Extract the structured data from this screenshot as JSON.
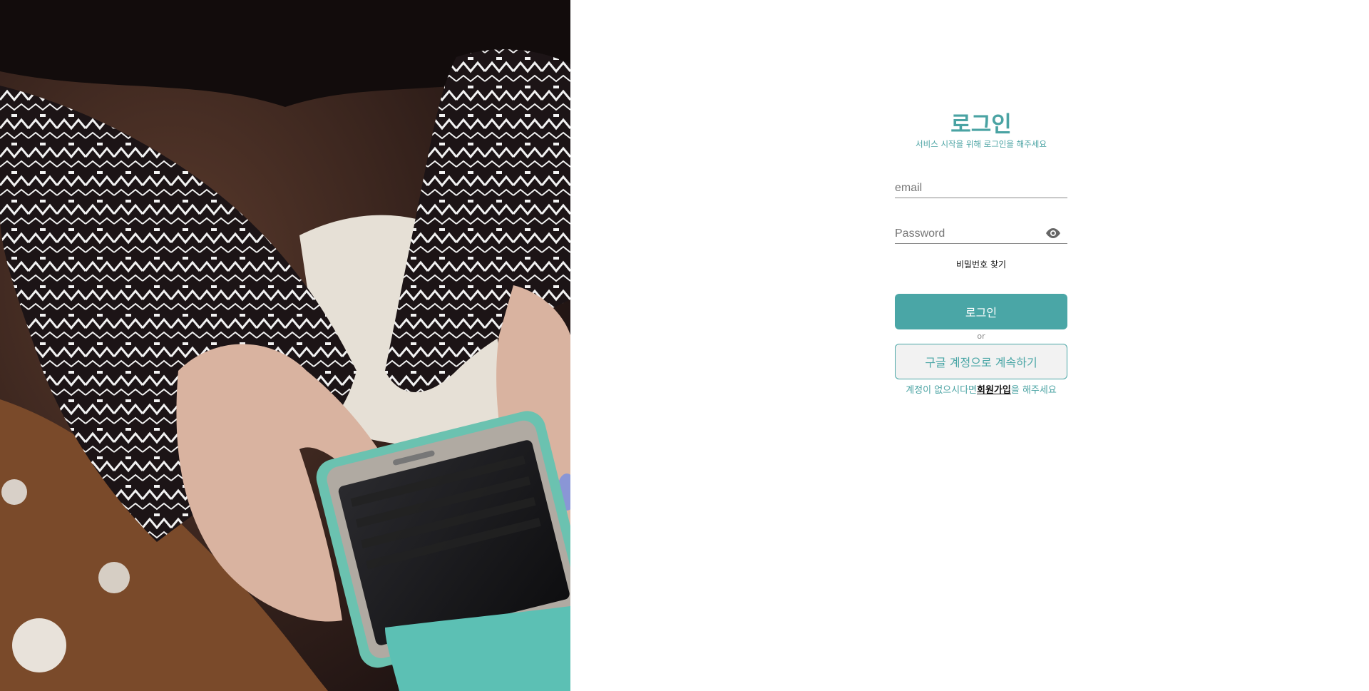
{
  "photo": {
    "description_icon": "photo-hands-holding-phone"
  },
  "login": {
    "title": "로그인",
    "subtitle": "서비스 시작을 위해 로그인을 해주세요",
    "email_placeholder": "email",
    "password_placeholder": "Password",
    "eye_icon": "eye-icon",
    "forgot_password": "비밀번호 찾기",
    "login_button": "로그인",
    "or_text": "or",
    "google_button": "구글 계정으로 계속하기",
    "signup_prefix": "계정이 없으시다면",
    "signup_link": "회원가입",
    "signup_suffix": "을 해주세요"
  },
  "colors": {
    "accent": "#4aa6a6",
    "google_button_bg": "#f2f2f2"
  }
}
